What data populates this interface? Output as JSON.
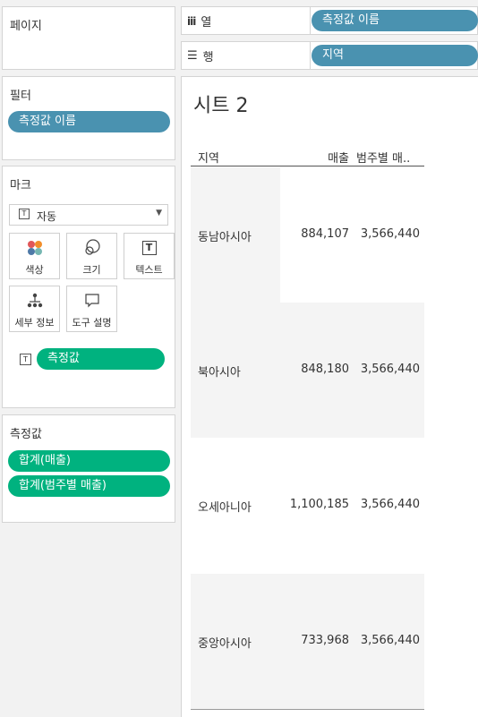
{
  "pages_card": {
    "title": "페이지"
  },
  "shelves": {
    "columns": {
      "label": "열",
      "pill": "측정값 이름"
    },
    "rows": {
      "label": "행",
      "pill": "지역"
    }
  },
  "filters_card": {
    "title": "필터",
    "pill": "측정값 이름"
  },
  "marks_card": {
    "title": "마크",
    "mark_type": "자동",
    "buttons": {
      "color": "색상",
      "size": "크기",
      "text": "텍스트",
      "detail": "세부 정보",
      "tooltip": "도구 설명"
    },
    "assigned_pill": "측정값"
  },
  "measures_card": {
    "title": "측정값",
    "pills": [
      "합계(매출)",
      "합계(범주별 매출)"
    ]
  },
  "colors": {
    "blue_pill": "#4a92b0",
    "green_pill": "#00b27f"
  },
  "sheet": {
    "title": "시트 2",
    "headers": {
      "region": "지역",
      "sales": "매출",
      "category_sales": "범주별 매.."
    },
    "rows": [
      {
        "region": "동남아시아",
        "sales": "884,107",
        "category_sales": "3,566,440"
      },
      {
        "region": "북아시아",
        "sales": "848,180",
        "category_sales": "3,566,440"
      },
      {
        "region": "오세아니아",
        "sales": "1,100,185",
        "category_sales": "3,566,440"
      },
      {
        "region": "중앙아시아",
        "sales": "733,968",
        "category_sales": "3,566,440"
      }
    ]
  }
}
